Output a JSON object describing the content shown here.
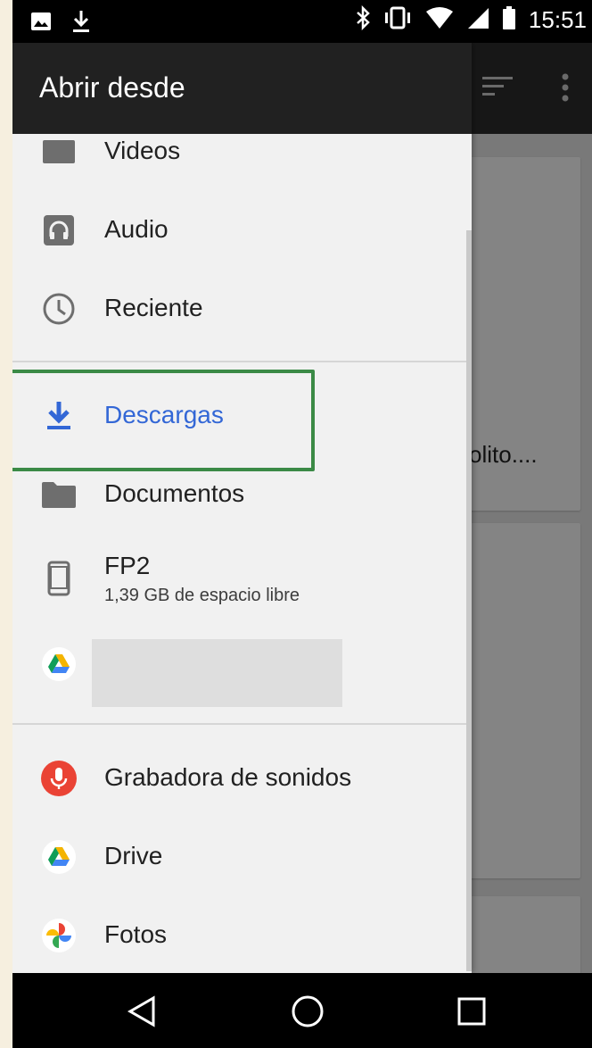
{
  "status_bar": {
    "time": "15:51"
  },
  "background": {
    "truncated_text": "olito...."
  },
  "drawer": {
    "title": "Abrir desde",
    "items": [
      {
        "label": "Videos",
        "icon": "video-icon"
      },
      {
        "label": "Audio",
        "icon": "audio-icon"
      },
      {
        "label": "Reciente",
        "icon": "clock-icon"
      },
      {
        "label": "Descargas",
        "icon": "download-icon",
        "selected": true
      },
      {
        "label": "Documentos",
        "icon": "folder-icon"
      },
      {
        "label": "FP2",
        "sublabel": "1,39 GB de espacio libre",
        "icon": "phone-icon"
      },
      {
        "label": "",
        "icon": "drive-icon"
      },
      {
        "label": "Grabadora de sonidos",
        "icon": "microphone-icon"
      },
      {
        "label": "Drive",
        "icon": "drive-icon"
      },
      {
        "label": "Fotos",
        "icon": "photos-pinwheel-icon"
      }
    ]
  },
  "colors": {
    "accent": "#3367d6",
    "highlight_box": "#3b8a46"
  },
  "nav_bar": {
    "back": "back-icon",
    "home": "home-icon",
    "recents": "recents-icon"
  }
}
